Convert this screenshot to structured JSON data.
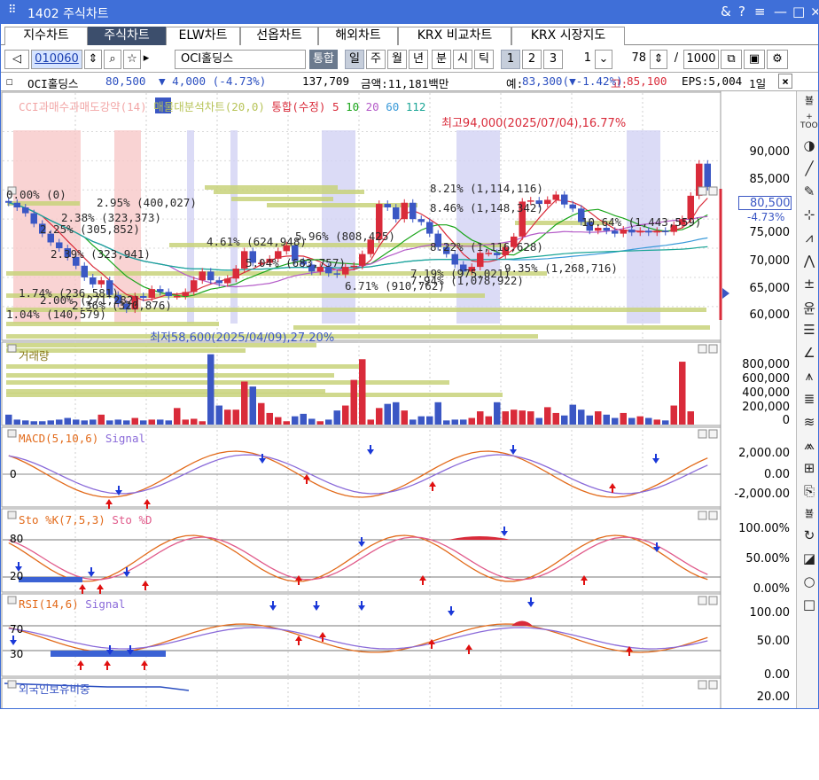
{
  "window": {
    "title": "1402 주식차트",
    "controls": [
      "&",
      "?",
      "≡",
      "—",
      "□",
      "×"
    ]
  },
  "tabs": [
    {
      "label": "지수차트",
      "active": false
    },
    {
      "label": "주식차트",
      "active": true
    },
    {
      "label": "ELW차트",
      "active": false
    },
    {
      "label": "선옵차트",
      "active": false
    },
    {
      "label": "해외차트",
      "active": false
    },
    {
      "label": "KRX 비교차트",
      "active": false
    },
    {
      "label": "KRX 시장지도",
      "active": false
    }
  ],
  "toolbar": {
    "code": "010060",
    "name": "OCI홀딩스",
    "period_buttons": [
      "통합",
      "일",
      "주",
      "월",
      "년",
      "분",
      "시",
      "틱"
    ],
    "numbers": [
      "1",
      "2",
      "3"
    ],
    "unit_value": "1",
    "count_value": "78",
    "total_value": "1000",
    "slash": "/"
  },
  "info": {
    "name": "OCI홀딩스",
    "price": "80,500",
    "change": "▼ 4,000 (-4.73%)",
    "volume": "137,709",
    "amount": "금액:11,181백만",
    "expected_label": "예:",
    "expected": "83,300(▼-1.42%)",
    "high_label": "고:",
    "high": "85,100",
    "eps": "EPS:5,004",
    "period": "1일"
  },
  "price_pane": {
    "legend": [
      {
        "text": "CCI과매수과매도강약(14)",
        "color": "#f2a6a6"
      },
      {
        "text": "매물대분석차트(20,0)",
        "color": "#c8d27a"
      },
      {
        "text": "통합(수정)",
        "color": "#d92b3a"
      },
      {
        "text": "5",
        "color": "#d92b3a"
      },
      {
        "text": "10",
        "color": "#1aa51a"
      },
      {
        "text": "20",
        "color": "#b45ac8"
      },
      {
        "text": "60",
        "color": "#3a9ad9"
      },
      {
        "text": "112",
        "color": "#1aa596"
      }
    ],
    "axis_labels": [
      "90,000",
      "85,000",
      "75,000",
      "70,000",
      "65,000",
      "60,000"
    ],
    "current_price": "80,500",
    "current_change": "-4.73%",
    "high_note": "최고94,000(2025/07/04),16.77%",
    "low_note": "최저58,600(2025/04/09),27.20%",
    "volume_profile_labels": [
      "0.00% (0)",
      "2.95% (400,027)",
      "2.38% (323,373)",
      "2.25% (305,852)",
      "2.39% (323,941)",
      "4.61% (624,948)",
      "5.96% (808,425)",
      "8.21% (1,114,116)",
      "8.46% (1,148,342)",
      "10.64% (1,443,559)",
      "8.22% (1,116,628)",
      "9.35% (1,268,716)",
      "7.19% (975,021)",
      "7.94% (1,078,922)",
      "6.71% (910,762)",
      "5.04% (683,757)",
      "1.74% (236,581)",
      "2.00% (271,282)",
      "2.36% (320,876)",
      "1.04% (140,579)"
    ]
  },
  "volume_pane": {
    "legend": "거래량",
    "axis_labels": [
      "800,000",
      "600,000",
      "400,000",
      "200,000",
      "0"
    ]
  },
  "macd_pane": {
    "legend_a": "MACD(5,10,6)",
    "legend_b": "Signal",
    "axis_labels": [
      "2,000.00",
      "0.00",
      "-2,000.00"
    ],
    "zero_label": "0"
  },
  "sto_pane": {
    "legend_a": "Sto %K(7,5,3)",
    "legend_b": "Sto %D",
    "axis_labels": [
      "100.00%",
      "50.00%",
      "0.00%"
    ],
    "levels": [
      "80",
      "20"
    ]
  },
  "rsi_pane": {
    "legend_a": "RSI(14,6)",
    "legend_b": "Signal",
    "axis_labels": [
      "100.00",
      "50.00",
      "0.00"
    ],
    "levels": [
      "70",
      "30"
    ]
  },
  "foreign_pane": {
    "legend": "외국인보유비중",
    "axis_labels": [
      "20.00"
    ]
  },
  "colors": {
    "up": "#d92b3a",
    "down": "#3b57c4",
    "title_bg": "#3f6fd8",
    "ma5": "#d92b3a",
    "ma10": "#1aa51a",
    "ma20": "#b45ac8",
    "ma60": "#3a9ad9",
    "ma112": "#1aa596"
  },
  "chart_data": {
    "type": "candlestick",
    "ylim": [
      58000,
      96000
    ],
    "candles_close": [
      77800,
      77000,
      76000,
      74200,
      72500,
      71000,
      70000,
      68500,
      67000,
      65000,
      63800,
      64500,
      62000,
      60500,
      59500,
      61800,
      61500,
      63000,
      62500,
      61800,
      61800,
      62500,
      64500,
      66000,
      64500,
      64000,
      64800,
      66500,
      69500,
      67500,
      67500,
      68200,
      69500,
      70500,
      67800,
      67200,
      66000,
      66800,
      65700,
      65500,
      66800,
      67000,
      69000,
      71500,
      77600,
      77000,
      75000,
      77800,
      75000,
      74500,
      72500,
      70200,
      69000,
      67200,
      66000,
      66800,
      69200,
      69200,
      68800,
      70200,
      72000,
      78000,
      78200,
      77600,
      78300,
      79200,
      77500,
      76800,
      74500,
      73000,
      73500,
      73000,
      72500,
      73200,
      72700,
      73000,
      72700,
      73000,
      72800,
      74000,
      75000,
      79000,
      84500,
      80500
    ],
    "volume": [
      120000,
      60000,
      50000,
      40000,
      40000,
      50000,
      60000,
      80000,
      60000,
      50000,
      60000,
      120000,
      50000,
      60000,
      50000,
      80000,
      50000,
      60000,
      60000,
      50000,
      200000,
      60000,
      70000,
      40000,
      850000,
      230000,
      180000,
      180000,
      520000,
      460000,
      260000,
      140000,
      90000,
      40000,
      100000,
      130000,
      70000,
      40000,
      60000,
      170000,
      230000,
      540000,
      790000,
      60000,
      200000,
      250000,
      270000,
      170000,
      60000,
      100000,
      100000,
      270000,
      50000,
      60000,
      60000,
      80000,
      160000,
      100000,
      270000,
      160000,
      180000,
      170000,
      160000,
      80000,
      210000,
      140000,
      110000,
      240000,
      180000,
      110000,
      160000,
      120000,
      80000,
      140000,
      80000,
      100000,
      80000,
      60000,
      50000,
      230000,
      760000,
      160000
    ]
  }
}
